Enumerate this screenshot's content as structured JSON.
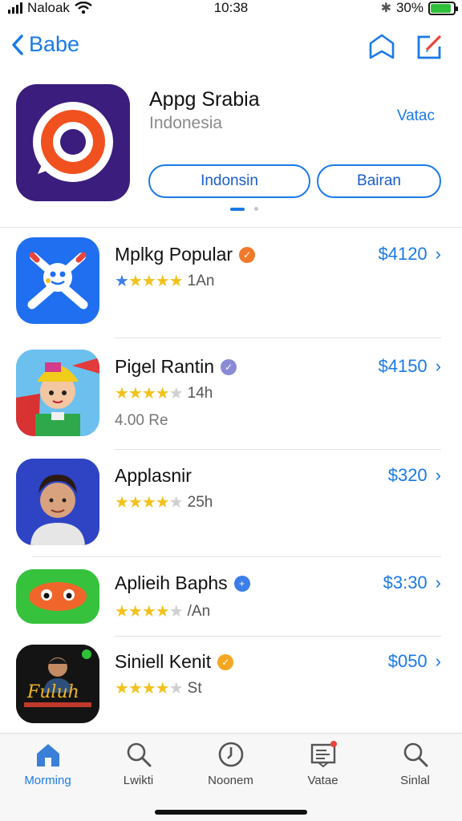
{
  "status_bar": {
    "carrier": "Naloak",
    "time": "10:38",
    "battery": "30%",
    "battery_level": 0.9
  },
  "nav": {
    "back_label": "Babe",
    "icons": [
      "bookmark-icon",
      "edit-icon"
    ]
  },
  "featured": {
    "title": "Appg Srabia",
    "subtitle": "Indonesia",
    "link_label": "Vatac",
    "button_left": "Indonsin",
    "button_right": "Bairan"
  },
  "apps": [
    {
      "name": "Mplkg Popular",
      "rating_stars": 5,
      "rating_text": "1An",
      "extra": "",
      "price": "$4120",
      "badge_color": "#f07a2a"
    },
    {
      "name": "Pigel Rantin",
      "rating_stars": 4,
      "rating_text": "14h",
      "extra": "4.00 Re",
      "price": "$4150",
      "badge_color": "#8a8ad6"
    },
    {
      "name": "Applasnir",
      "rating_stars": 4,
      "rating_text": "25h",
      "extra": "",
      "price": "$320",
      "badge_color": ""
    },
    {
      "name": "Aplieih Baphs",
      "rating_stars": 4,
      "rating_text": "/An",
      "extra": "",
      "price": "$3:30",
      "badge_color": "#3c7ee8"
    },
    {
      "name": "Siniell Kenit",
      "rating_stars": 4,
      "rating_text": "St",
      "extra": "",
      "price": "$050",
      "badge_color": "#f5a623"
    }
  ],
  "tabs": [
    {
      "label": "Morming",
      "icon": "home-icon",
      "active": true
    },
    {
      "label": "Lwikti",
      "icon": "search-icon",
      "active": false
    },
    {
      "label": "Noonem",
      "icon": "clock-icon",
      "active": false
    },
    {
      "label": "Vatae",
      "icon": "updates-icon",
      "active": false
    },
    {
      "label": "Sinlal",
      "icon": "search-icon",
      "active": false
    }
  ],
  "colors": {
    "accent": "#1a7ae6",
    "star": "#f2c21b"
  }
}
